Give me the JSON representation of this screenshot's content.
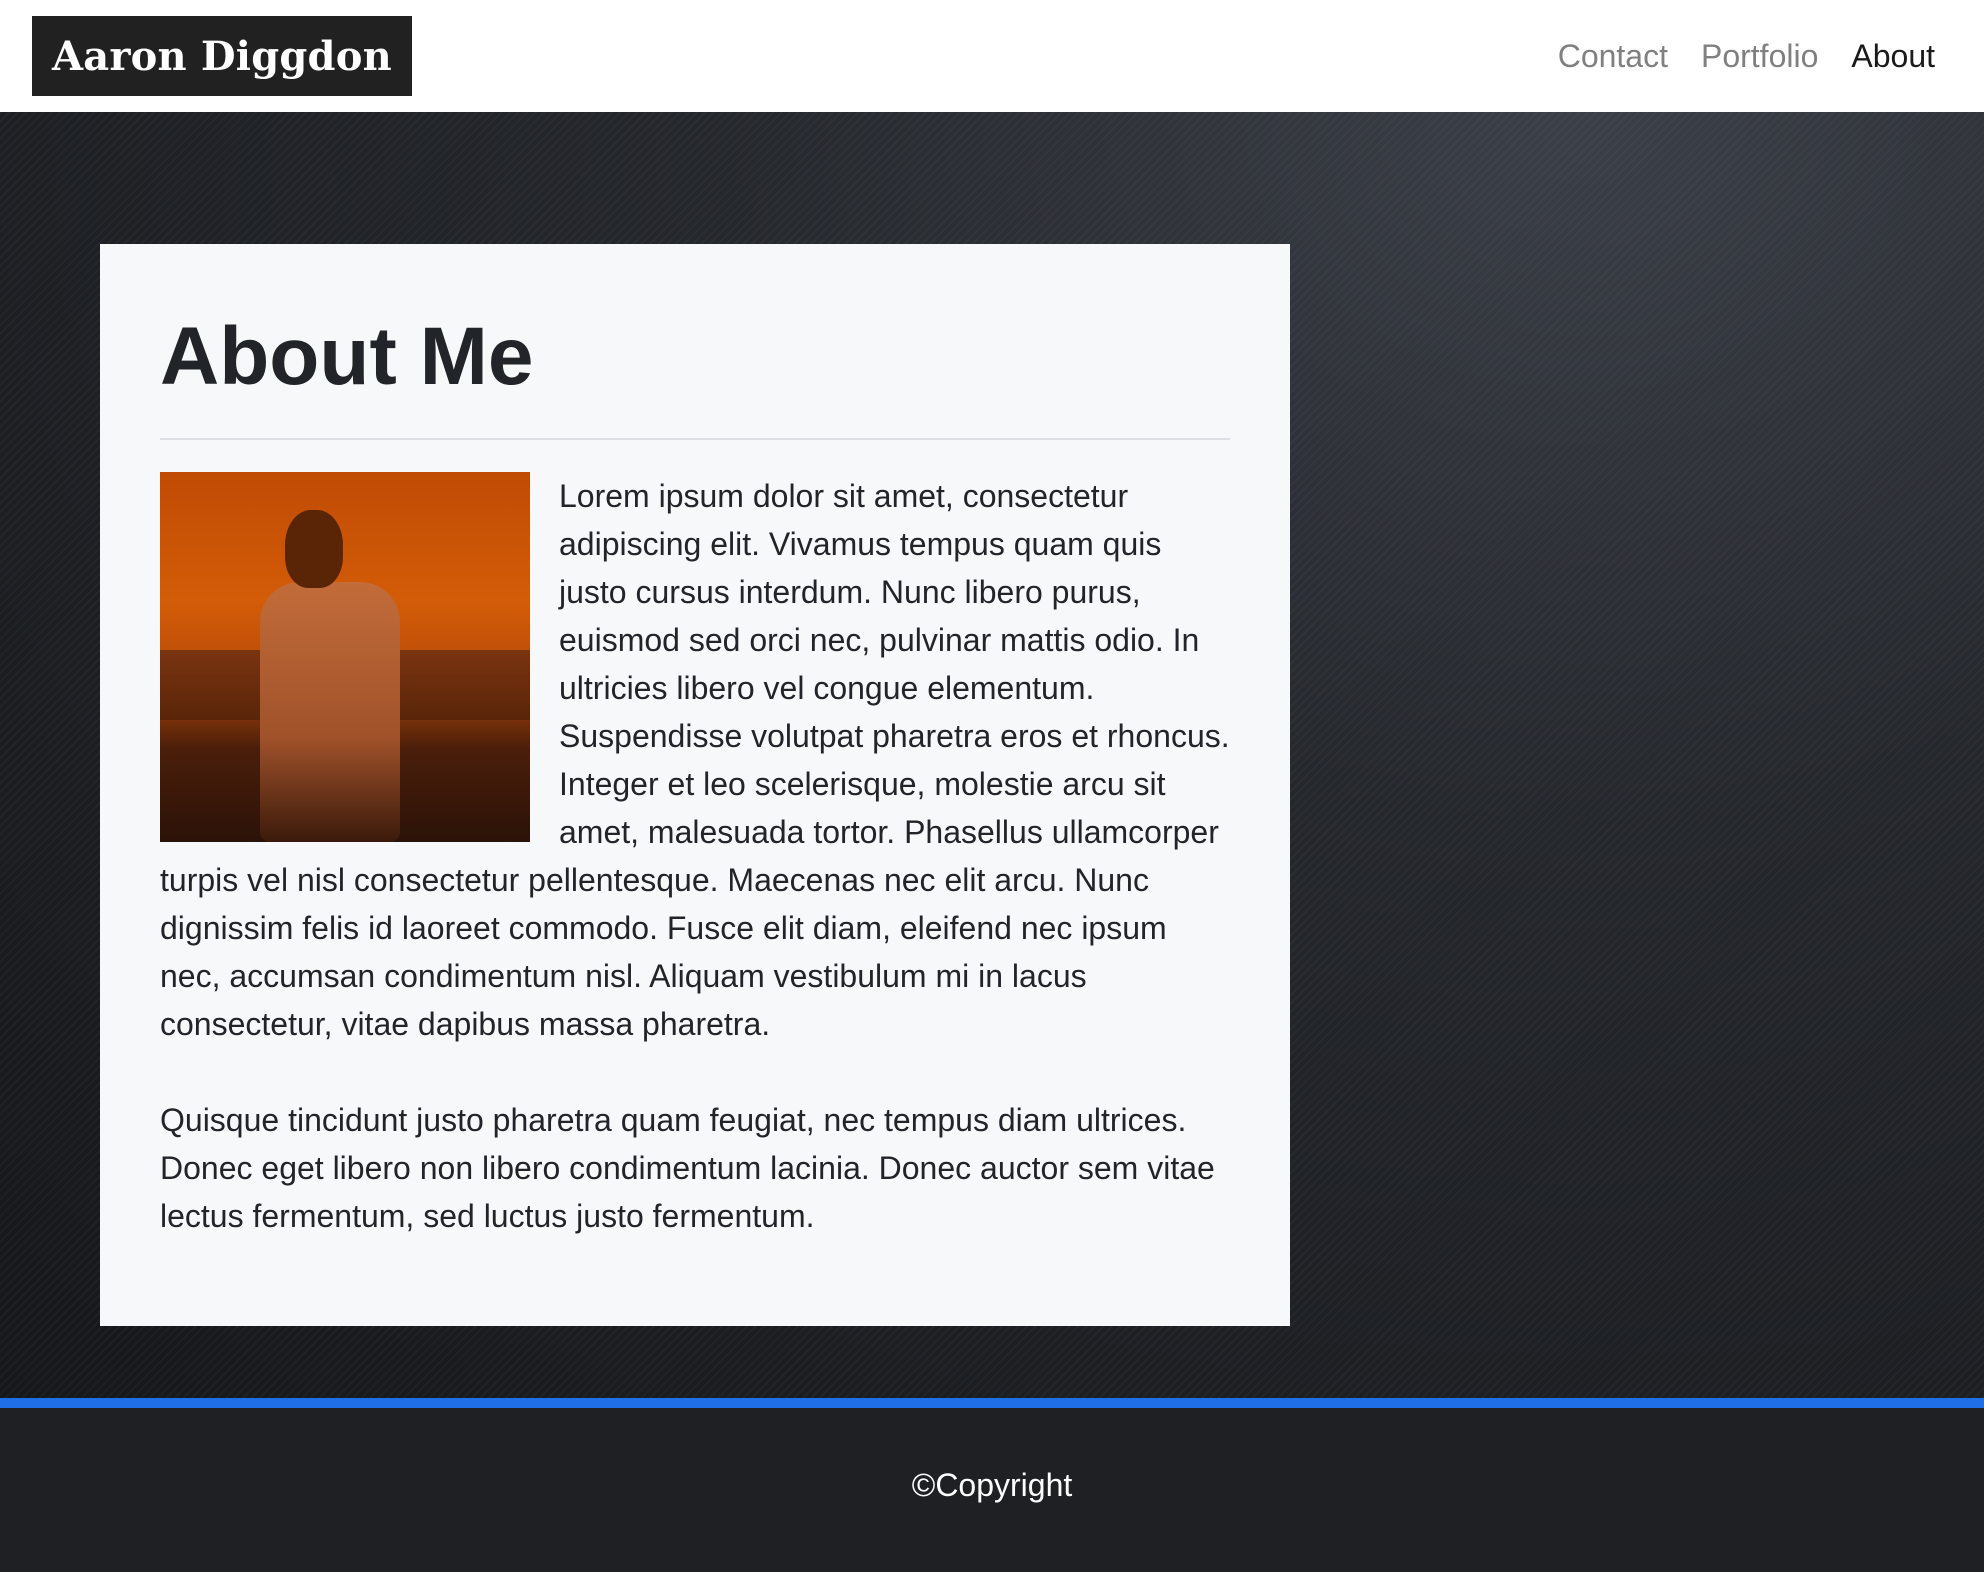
{
  "header": {
    "brand": "Aaron Diggdon",
    "nav": [
      {
        "label": "Contact",
        "active": false
      },
      {
        "label": "Portfolio",
        "active": false
      },
      {
        "label": "About",
        "active": true
      }
    ]
  },
  "about": {
    "title": "About Me",
    "photo_description": "portrait-photo",
    "paragraphs": [
      "Lorem ipsum dolor sit amet, consectetur adipiscing elit. Vivamus tempus quam quis justo cursus interdum. Nunc libero purus, euismod sed orci nec, pulvinar mattis odio. In ultricies libero vel congue elementum. Suspendisse volutpat pharetra eros et rhoncus. Integer et leo scelerisque, molestie arcu sit amet, malesuada tortor. Phasellus ullamcorper turpis vel nisl consectetur pellentesque. Maecenas nec elit arcu. Nunc dignissim felis id laoreet commodo. Fusce elit diam, eleifend nec ipsum nec, accumsan condimentum nisl. Aliquam vestibulum mi in lacus consectetur, vitae dapibus massa pharetra.",
      "Quisque tincidunt justo pharetra quam feugiat, nec tempus diam ultrices. Donec eget libero non libero condimentum lacinia. Donec auctor sem vitae lectus fermentum, sed luctus justo fermentum."
    ]
  },
  "footer": {
    "copyright": "©Copyright"
  },
  "colors": {
    "accent_bar": "#1e6fe8",
    "brand_bg": "#212121",
    "card_bg": "#f7f8fa",
    "footer_bg": "#1f2023"
  }
}
